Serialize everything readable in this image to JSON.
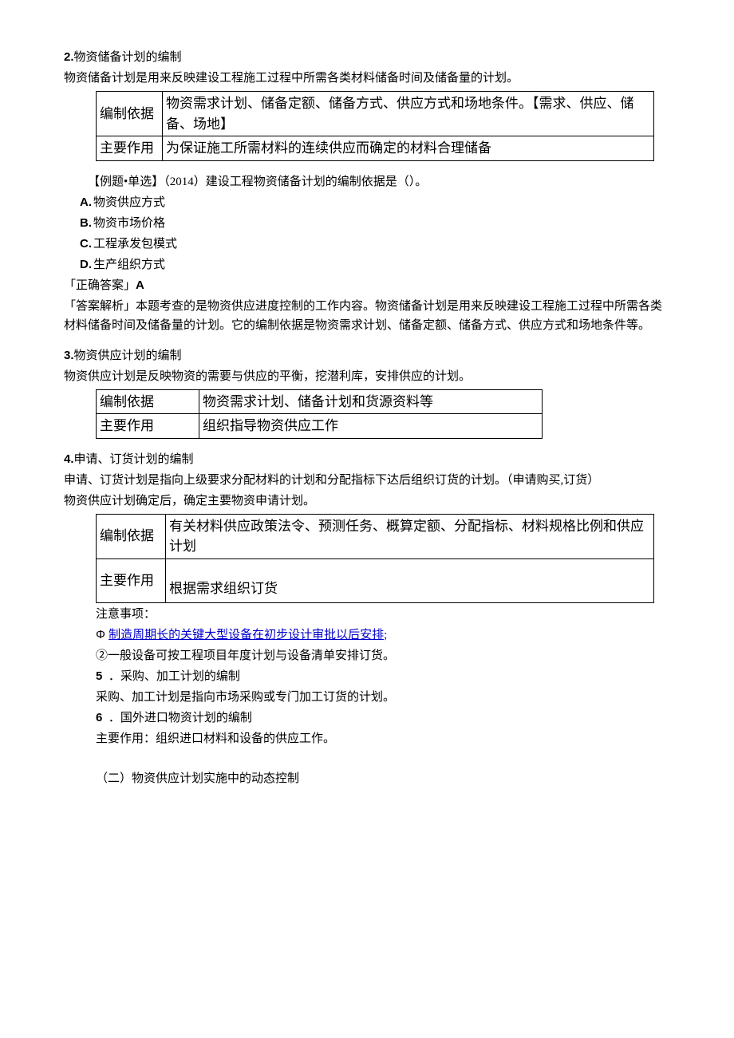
{
  "s2": {
    "num": "2.",
    "title": "物资储备计划的编制",
    "desc": "物资储备计划是用来反映建设工程施工过程中所需各类材料储备时间及储备量的计划。",
    "table": {
      "r1c1": "编制依据",
      "r1c2": "物资需求计划、储备定额、储备方式、供应方式和场地条件。【需求、供应、储备、场地】",
      "r2c1": "主要作用",
      "r2c2": "为保证施工所需材料的连续供应而确定的材料合理储备"
    },
    "example": {
      "prefix": "【例题•单选】（2014）建设工程物资储备计划的编制依据是（）。",
      "a_label": "A.",
      "a": "物资供应方式",
      "b_label": "B.",
      "b": "物资市场价格",
      "c_label": "C.",
      "c": "工程承发包模式",
      "d_label": "D.",
      "d": "生产组织方式",
      "ans_prefix": "「正确答案」",
      "ans": "A",
      "exp": "「答案解析」本题考查的是物资供应进度控制的工作内容。物资储备计划是用来反映建设工程施工过程中所需各类材料储备时间及储备量的计划。它的编制依据是物资需求计划、储备定额、储备方式、供应方式和场地条件等。"
    }
  },
  "s3": {
    "num": "3.",
    "title": "物资供应计划的编制",
    "desc": "物资供应计划是反映物资的需要与供应的平衡，挖潜利库，安排供应的计划。",
    "table": {
      "r1c1": "编制依据",
      "r1c2": "物资需求计划、储备计划和货源资料等",
      "r2c1": "主要作用",
      "r2c2": "组织指导物资供应工作"
    }
  },
  "s4": {
    "num": "4.",
    "title": "申请、订货计划的编制",
    "desc1": "申请、订货计划是指向上级要求分配材料的计划和分配指标下达后组织订货的计划。（申请购买,订货）",
    "desc2": "物资供应计划确定后，确定主要物资申请计划。",
    "table": {
      "r1c1": "编制依据",
      "r1c2": "有关材料供应政策法令、预测任务、概算定额、分配指标、材料规格比例和供应计划",
      "r2c1": "主要作用",
      "r2c2": "根据需求组织订货"
    },
    "note_title": "注意事项：",
    "note1_mark": "Φ ",
    "note1": "制造周期长的关键大型设备在初步设计审批以后安排;",
    "note2": "②一般设备可按工程项目年度计划与设备清单安排订货。"
  },
  "s5": {
    "num": "5",
    "dot": "．",
    "title": "采购、加工计划的编制",
    "desc": "采购、加工计划是指向市场采购或专门加工订货的计划。"
  },
  "s6": {
    "num": "6",
    "dot": "．",
    "title": "国外进口物资计划的编制",
    "desc": "主要作用：组织进口材料和设备的供应工作。"
  },
  "sub2": {
    "title": "（二）物资供应计划实施中的动态控制"
  }
}
